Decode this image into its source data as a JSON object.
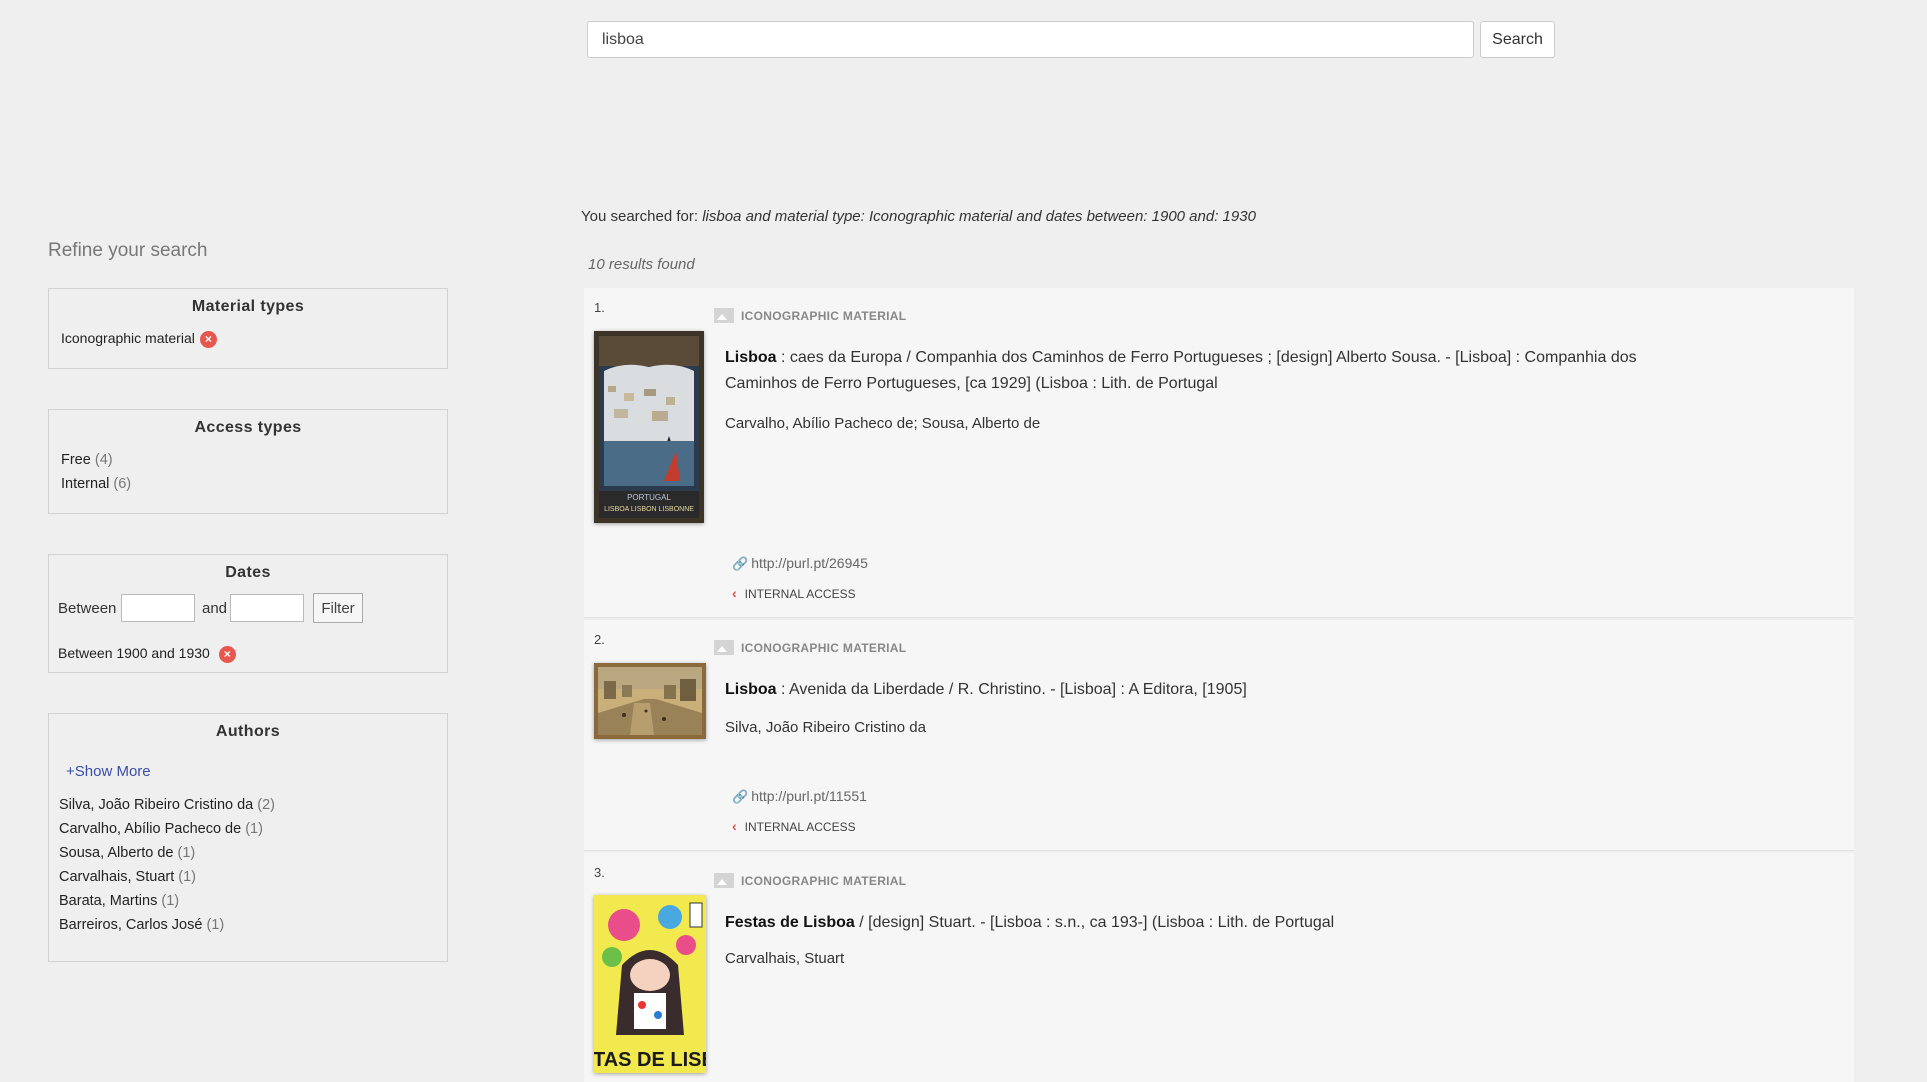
{
  "search": {
    "value": "lisboa",
    "button_label": "Search"
  },
  "sidebar": {
    "title": "Refine your search",
    "material_types": {
      "title": "Material types",
      "selected": "Iconographic material"
    },
    "access_types": {
      "title": "Access types",
      "items": [
        {
          "label": "Free",
          "count": "(4)"
        },
        {
          "label": "Internal",
          "count": "(6)"
        }
      ]
    },
    "dates": {
      "title": "Dates",
      "between_label": "Between",
      "and_label": "and",
      "filter_label": "Filter",
      "from_value": "",
      "to_value": "",
      "selected": "Between 1900 and 1930"
    },
    "authors": {
      "title": "Authors",
      "show_more": "+Show More",
      "items": [
        {
          "label": "Silva, João Ribeiro Cristino da",
          "count": "(2)"
        },
        {
          "label": "Carvalho, Abílio Pacheco de",
          "count": "(1)"
        },
        {
          "label": "Sousa, Alberto de",
          "count": "(1)"
        },
        {
          "label": "Carvalhais, Stuart",
          "count": "(1)"
        },
        {
          "label": "Barata, Martins",
          "count": "(1)"
        },
        {
          "label": "Barreiros, Carlos José",
          "count": "(1)"
        }
      ]
    }
  },
  "summary": {
    "prefix": "You searched for: ",
    "query": "lisboa and material type: Iconographic material and dates between: 1900 and: 1930",
    "results_found": "10 results found"
  },
  "results": [
    {
      "number": "1.",
      "type": "ICONOGRAPHIC MATERIAL",
      "title_bold": "Lisboa",
      "title_rest": " : caes da Europa / Companhia dos Caminhos de Ferro Portugueses ; [design] Alberto Sousa. - [Lisboa] : Companhia dos Caminhos de Ferro Portugueses, [ca 1929] (Lisboa : Lith. de Portugal",
      "author": "Carvalho, Abílio Pacheco de; Sousa, Alberto de",
      "link": "http://purl.pt/26945",
      "access": "INTERNAL ACCESS",
      "thumb_text": "PORTUGAL LISBOA LISBON LISBONNE"
    },
    {
      "number": "2.",
      "type": "ICONOGRAPHIC MATERIAL",
      "title_bold": "Lisboa",
      "title_rest": " : Avenida da Liberdade / R. Christino. - [Lisboa] : A Editora, [1905]",
      "author": "Silva, João Ribeiro Cristino da",
      "link": "http://purl.pt/11551",
      "access": "INTERNAL ACCESS"
    },
    {
      "number": "3.",
      "type": "ICONOGRAPHIC MATERIAL",
      "title_bold": "Festas de Lisboa",
      "title_rest": " / [design] Stuart. - [Lisboa : s.n., ca 193-] (Lisboa : Lith. de Portugal",
      "author": "Carvalhais, Stuart",
      "thumb_text": "FESTAS DE LISBOA"
    }
  ],
  "colors": {
    "background": "#efefef",
    "remove": "#e6584d",
    "link": "#3a4ea8",
    "access_chevron": "#d9534f"
  }
}
